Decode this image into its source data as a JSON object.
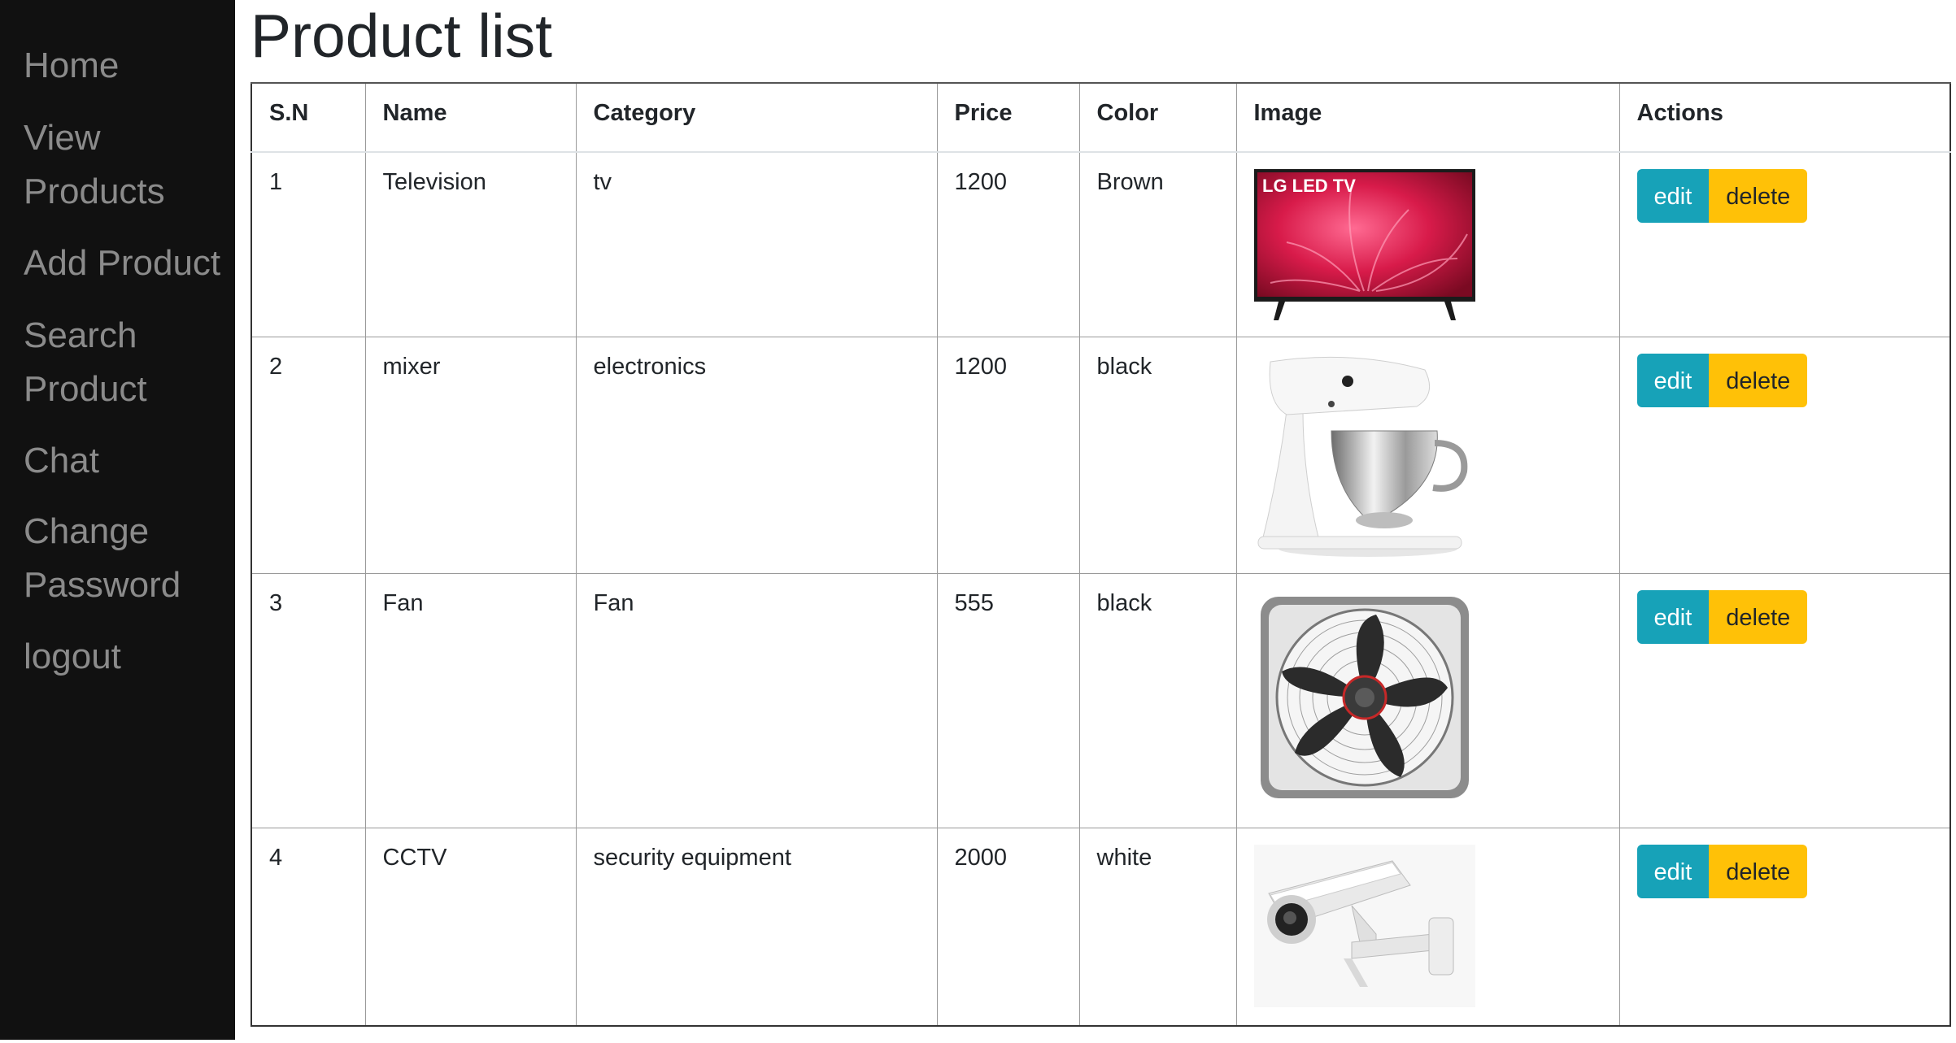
{
  "nav": {
    "home": "Home",
    "view_products": "View Products",
    "add_product": "Add Product",
    "search_product": "Search Product",
    "chat": "Chat",
    "change_password": "Change Password",
    "logout": "logout"
  },
  "page": {
    "title": "Product list"
  },
  "table": {
    "headers": {
      "sn": "S.N",
      "name": "Name",
      "category": "Category",
      "price": "Price",
      "color": "Color",
      "image": "Image",
      "actions": "Actions"
    },
    "rows": [
      {
        "sn": "1",
        "name": "Television",
        "category": "tv",
        "price": "1200",
        "color": "Brown",
        "image_icon": "television-image",
        "image_text": "LG LED TV",
        "edit": "edit",
        "delete": "delete"
      },
      {
        "sn": "2",
        "name": "mixer",
        "category": "electronics",
        "price": "1200",
        "color": "black",
        "image_icon": "stand-mixer-image",
        "edit": "edit",
        "delete": "delete"
      },
      {
        "sn": "3",
        "name": "Fan",
        "category": "Fan",
        "price": "555",
        "color": "black",
        "image_icon": "box-fan-image",
        "edit": "edit",
        "delete": "delete"
      },
      {
        "sn": "4",
        "name": "CCTV",
        "category": "security equipment",
        "price": "2000",
        "color": "white",
        "image_icon": "cctv-camera-image",
        "edit": "edit",
        "delete": "delete"
      }
    ]
  },
  "colors": {
    "sidebar_bg": "#111111",
    "sidebar_link": "#8b8b8b",
    "edit_button": "#17a2b8",
    "delete_button": "#ffc107"
  }
}
